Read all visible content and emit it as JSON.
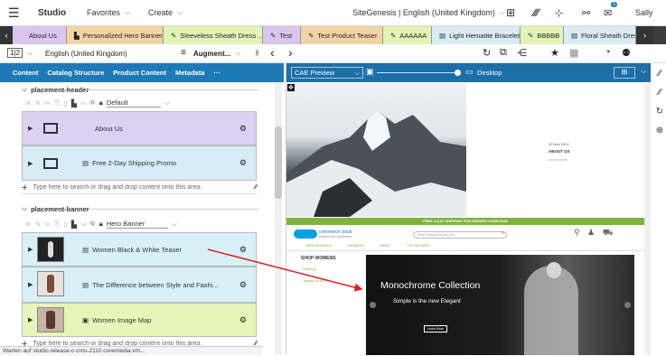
{
  "topbar": {
    "menu_label": "≡",
    "app_name": "Studio",
    "favorites": "Favorites",
    "create": "Create",
    "site_selector": "SiteGenesis | English (United Kingdom)",
    "notification_count": "1",
    "user": "Sally"
  },
  "tabs": [
    {
      "label": "About Us",
      "color": "#d9c6ef",
      "icon": "page-icon"
    },
    {
      "label": "Personalized Hero Banner",
      "color": "#f1d4a6",
      "icon": "personalized-icon"
    },
    {
      "label": "Sleeveless Sheath Dress ...",
      "color": "#e3f3b6",
      "icon": "pencil-icon"
    },
    {
      "label": "Test",
      "color": "#d9c6ef",
      "icon": "pencil-icon"
    },
    {
      "label": "Test Product Teaser",
      "color": "#f1d4a6",
      "icon": "pencil-icon"
    },
    {
      "label": "AAAAAA",
      "color": "#e3f3b6",
      "icon": "pencil-icon"
    },
    {
      "label": "Light Hematite Bracelet",
      "color": "#d9ecf3",
      "icon": "product-icon"
    },
    {
      "label": "BBBBB",
      "color": "#e3f3b6",
      "icon": "pencil-icon"
    },
    {
      "label": "Floral Sheath Dress",
      "color": "#d9ecf3",
      "icon": "product-icon"
    }
  ],
  "toolbar": {
    "locale": "English (United Kingdom)",
    "layout": "Augment..."
  },
  "left": {
    "subtabs": [
      "Content",
      "Catalog Structure",
      "Product Content",
      "Metadata",
      "···"
    ],
    "section1": {
      "title": "placement-header",
      "view": "Default",
      "items": [
        "About Us",
        "Free 2-Day Shipping Promo"
      ],
      "add_placeholder": "Type here to search or drag and drop content onto this area."
    },
    "section2": {
      "title": "placement-banner",
      "view": "Hero Banner",
      "items": [
        "Women Black & White Teaser",
        "The Difference between Style and Fashi...",
        "Women Image Map"
      ],
      "add_placeholder": "Type here to search or drag and drop content onto this area."
    }
  },
  "preview": {
    "mode": "CAE Preview",
    "device": "Desktop",
    "date": "29 Nov 2021",
    "about_title": "ABOUT US",
    "learn_more": "Learn More",
    "shipping": "FREE 2-DAY SHIPPING FOR ORDERS OVER $150",
    "brand": "commerce cloud",
    "brand_sub": "powered by CoreMedia",
    "search_placeholder": "Enter Keyword or Item No.",
    "nav": [
      "NEW ARRIVALS",
      "WOMENS",
      "MENS",
      "TOP SELLERS"
    ],
    "shop": "SHOP WOMENS",
    "side_links": [
      "Clothing",
      "Jewelry & Acc..."
    ],
    "hero_title": "Monochrome Collection",
    "hero_sub": "Simple is the new Elegant",
    "hero_btn": "Learn More"
  },
  "status": "Warten auf studio.release-c-cms-2110.coremedia.vm..."
}
